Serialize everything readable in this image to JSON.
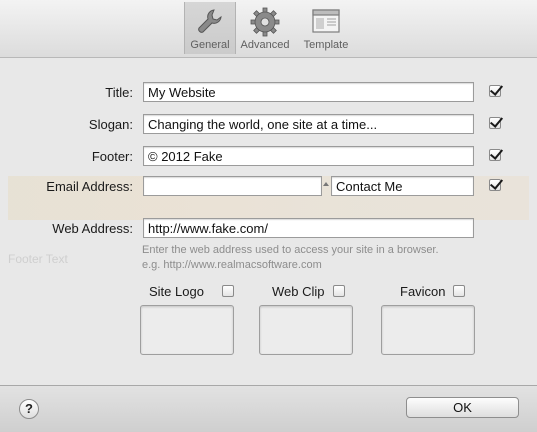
{
  "toolbar": {
    "tabs": [
      {
        "label": "General",
        "icon": "wrench-icon",
        "selected": true
      },
      {
        "label": "Advanced",
        "icon": "gear-icon",
        "selected": false
      },
      {
        "label": "Template",
        "icon": "template-icon",
        "selected": false
      }
    ]
  },
  "form": {
    "title": {
      "label": "Title:",
      "value": "My Website",
      "checked": true
    },
    "slogan": {
      "label": "Slogan:",
      "value": "Changing the world, one site at a time...",
      "checked": true
    },
    "footer": {
      "label": "Footer:",
      "value": "© 2012 Fake",
      "checked": true
    },
    "email": {
      "label": "Email Address:",
      "value": "",
      "link_text": "Contact Me",
      "checked": true
    },
    "web": {
      "label": "Web Address:",
      "value": "http://www.fake.com/",
      "help_line1": "Enter the web address used to access your site in a browser.",
      "help_line2": "e.g. http://www.realmacsoftware.com"
    }
  },
  "media": {
    "site_logo": {
      "label": "Site Logo",
      "checked": false
    },
    "web_clip": {
      "label": "Web Clip",
      "checked": false
    },
    "favicon": {
      "label": "Favicon",
      "checked": false
    }
  },
  "background": {
    "ghost_label": "Footer Text"
  },
  "buttons": {
    "help": "?",
    "ok": "OK"
  },
  "colors": {
    "toolbar": "#dcdcdc",
    "content": "#e8e8e8",
    "help_text": "#8d8d8d"
  }
}
